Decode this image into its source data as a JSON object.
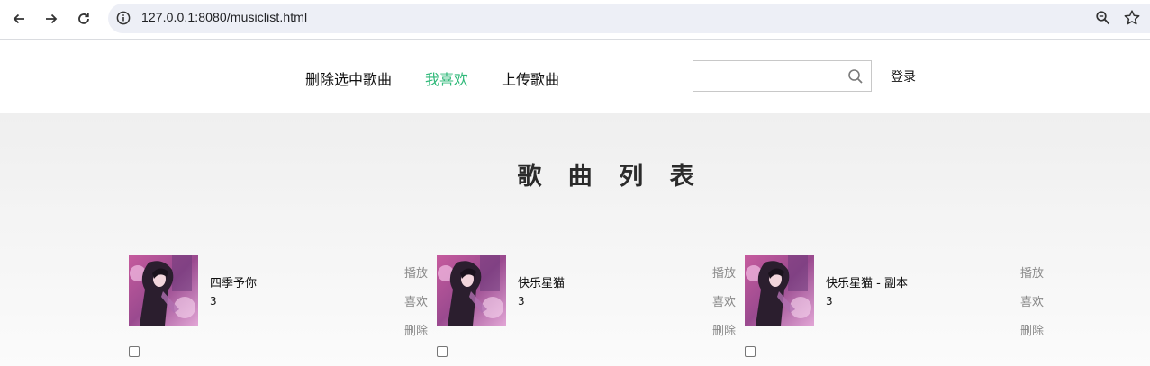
{
  "browser": {
    "url": "127.0.0.1:8080/musiclist.html"
  },
  "header": {
    "menu": [
      {
        "label": "删除选中歌曲",
        "active": false
      },
      {
        "label": "我喜欢",
        "active": true
      },
      {
        "label": "上传歌曲",
        "active": false
      }
    ],
    "search": {
      "value": "",
      "placeholder": ""
    },
    "login_label": "登录",
    "accent_color": "#31b97a"
  },
  "main": {
    "title": "歌 曲 列 表",
    "songs": [
      {
        "name": "四季予你",
        "singer": "3",
        "actions": {
          "play": "播放",
          "like": "喜欢",
          "delete": "删除"
        },
        "checked": false
      },
      {
        "name": "快乐星猫",
        "singer": "3",
        "actions": {
          "play": "播放",
          "like": "喜欢",
          "delete": "删除"
        },
        "checked": false
      },
      {
        "name": "快乐星猫 - 副本",
        "singer": "3",
        "actions": {
          "play": "播放",
          "like": "喜欢",
          "delete": "删除"
        },
        "checked": false
      }
    ]
  }
}
